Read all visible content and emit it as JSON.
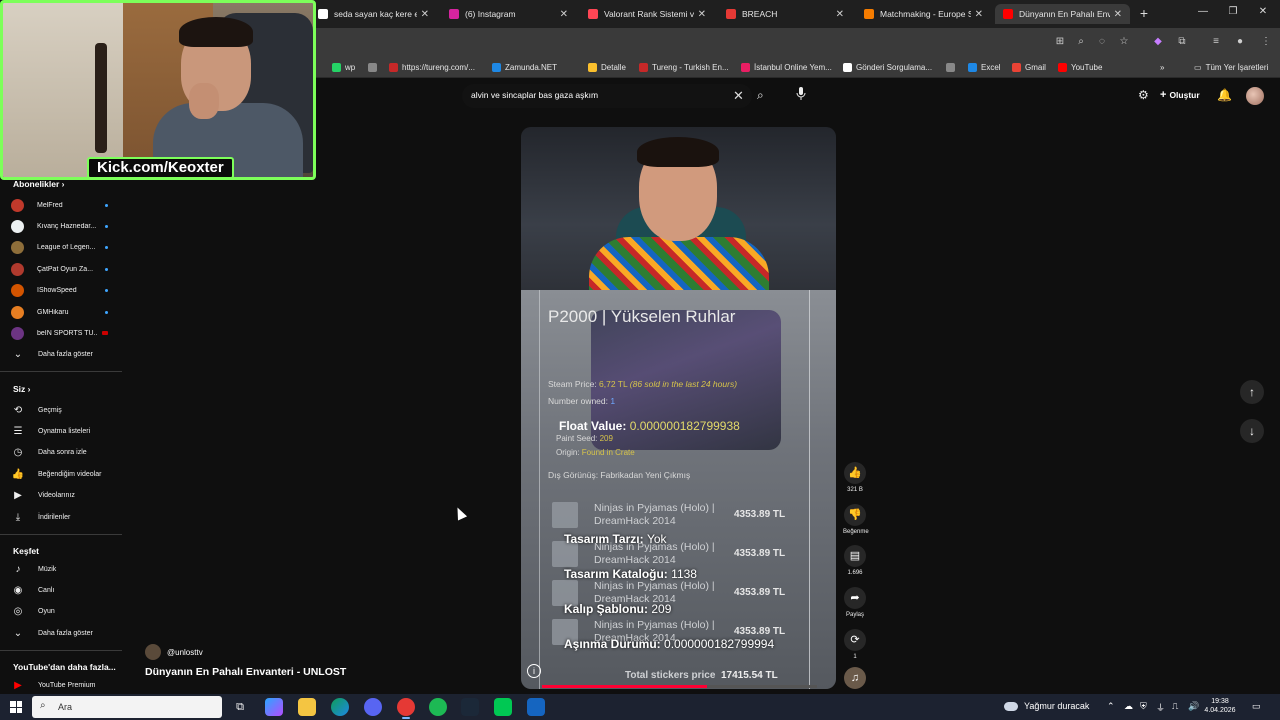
{
  "browser": {
    "tabs": [
      {
        "label": "seda sayan kaç kere evlendi",
        "favicon_color": "#ffffff",
        "active": false
      },
      {
        "label": "(6) Instagram",
        "favicon_color": "#d6249f",
        "active": false
      },
      {
        "label": "Valorant Rank Sistemi ve Ligler",
        "favicon_color": "#ff4655",
        "active": false
      },
      {
        "label": "BREACH",
        "favicon_color": "#e53935",
        "active": false
      },
      {
        "label": "Matchmaking - Europe Server",
        "favicon_color": "#f57c00",
        "active": false
      },
      {
        "label": "Dünyanın En Pahalı Envanteri",
        "favicon_color": "#ff0000",
        "active": true
      }
    ],
    "bookmarks": [
      {
        "label": "wp",
        "favicon_color": "#25d366"
      },
      {
        "label": "",
        "favicon_color": "#888888"
      },
      {
        "label": "https://tureng.com/...",
        "favicon_color": "#c62828"
      },
      {
        "label": "Zamunda.NET",
        "favicon_color": "#1e88e5"
      },
      {
        "label": "Detalle",
        "favicon_color": "#fbc02d"
      },
      {
        "label": "Tureng - Turkish En...",
        "favicon_color": "#c62828"
      },
      {
        "label": "İstanbul Online Yem...",
        "favicon_color": "#e91e63"
      },
      {
        "label": "Gönderi Sorgulama...",
        "favicon_color": "#ffffff"
      },
      {
        "label": "",
        "favicon_color": "#888888"
      },
      {
        "label": "Excel",
        "favicon_color": "#1e88e5"
      },
      {
        "label": "Gmail",
        "favicon_color": "#ea4335"
      },
      {
        "label": "YouTube",
        "favicon_color": "#ff0000"
      }
    ],
    "all_bookmarks_label": "Tüm Yer İşaretleri"
  },
  "webcam": {
    "overlay_text": "Kick.com/Keoxter"
  },
  "youtube": {
    "search_query": "alvin ve sincaplar bas gaza aşkım",
    "create_label": "Oluştur",
    "sidebar": {
      "subscriptions_title": "Abonelikler",
      "subscriptions": [
        {
          "name": "MelFred",
          "avatar_color": "#c0392b",
          "badge": "dot"
        },
        {
          "name": "Kıvanç Haznedar...",
          "avatar_color": "#ecf0f1",
          "badge": "dot"
        },
        {
          "name": "League of Legen...",
          "avatar_color": "#8e6e3a",
          "badge": "dot"
        },
        {
          "name": "ÇatPat Oyun Za...",
          "avatar_color": "#b03a2e",
          "badge": "dot"
        },
        {
          "name": "IShowSpeed",
          "avatar_color": "#d35400",
          "badge": "dot"
        },
        {
          "name": "GMHikaru",
          "avatar_color": "#e67e22",
          "badge": "dot"
        },
        {
          "name": "beIN SPORTS TÜ...",
          "avatar_color": "#6c3483",
          "badge": "live"
        }
      ],
      "show_more": "Daha fazla göster",
      "you_title": "Siz",
      "you_items": [
        {
          "icon": "history-icon",
          "glyph": "⟲",
          "label": "Geçmiş"
        },
        {
          "icon": "playlist-icon",
          "glyph": "☰",
          "label": "Oynatma listeleri"
        },
        {
          "icon": "watch-later-icon",
          "glyph": "◷",
          "label": "Daha sonra izle"
        },
        {
          "icon": "liked-icon",
          "glyph": "👍",
          "label": "Beğendiğim videolar"
        },
        {
          "icon": "your-videos-icon",
          "glyph": "▶",
          "label": "Videolarınız"
        },
        {
          "icon": "download-icon",
          "glyph": "⤓",
          "label": "İndirilenler"
        }
      ],
      "explore_title": "Keşfet",
      "explore_items": [
        {
          "icon": "music-icon",
          "glyph": "♪",
          "label": "Müzik"
        },
        {
          "icon": "live-icon",
          "glyph": "◉",
          "label": "Canlı"
        },
        {
          "icon": "gaming-icon",
          "glyph": "◎",
          "label": "Oyun"
        }
      ],
      "explore_more": "Daha fazla göster",
      "more_title": "YouTube'dan daha fazla...",
      "more_items": [
        {
          "icon": "youtube-premium-icon",
          "label": "YouTube Premium"
        }
      ]
    },
    "short": {
      "channel": "@unlosttv",
      "title": "Dünyanın En Pahalı Envanteri - UNLOST",
      "progress": 0.6,
      "skin": {
        "title": "P2000 | Yükselen Ruhlar",
        "steam_price_label": "Steam Price:",
        "steam_price": "6,72 TL",
        "steam_sold": "(86 sold in the last 24 hours)",
        "number_owned_label": "Number owned:",
        "number_owned": "1",
        "float_label": "Float Value:",
        "float_value": "0.000000182799938",
        "paint_seed_label": "Paint Seed:",
        "paint_seed": "209",
        "origin_label": "Origin:",
        "origin": "Found in Crate",
        "exterior": "Dış Görünüş: Fabrikadan Yeni Çıkmış"
      },
      "stickers": [
        {
          "name": "Ninjas in Pyjamas (Holo) | DreamHack 2014",
          "price": "4353.89 TL"
        },
        {
          "name": "Ninjas in Pyjamas (Holo) | DreamHack 2014",
          "price": "4353.89 TL"
        },
        {
          "name": "Ninjas in Pyjamas (Holo) | DreamHack 2014",
          "price": "4353.89 TL"
        },
        {
          "name": "Ninjas in Pyjamas (Holo) | DreamHack 2014",
          "price": "4353.89 TL"
        }
      ],
      "overlay": {
        "style_label": "Tasarım Tarzı:",
        "style_value": "Yok",
        "catalog_label": "Tasarım Kataloğu:",
        "catalog_value": "1138",
        "pattern_label": "Kalıp Şablonu:",
        "pattern_value": "209",
        "wear_label": "Aşınma Durumu:",
        "wear_value": "0.000000182799994"
      },
      "total_label": "Total stickers price",
      "total_value": "17415.54 TL"
    },
    "actions": {
      "like_count": "321 B",
      "dislike_label": "Beğenme",
      "comments_count": "1.696",
      "share_label": "Paylaş",
      "remix_count": "1"
    }
  },
  "taskbar": {
    "search_placeholder": "Ara",
    "weather": "Yağmur duracak",
    "time": "19:38",
    "date": "4.04.2026"
  }
}
